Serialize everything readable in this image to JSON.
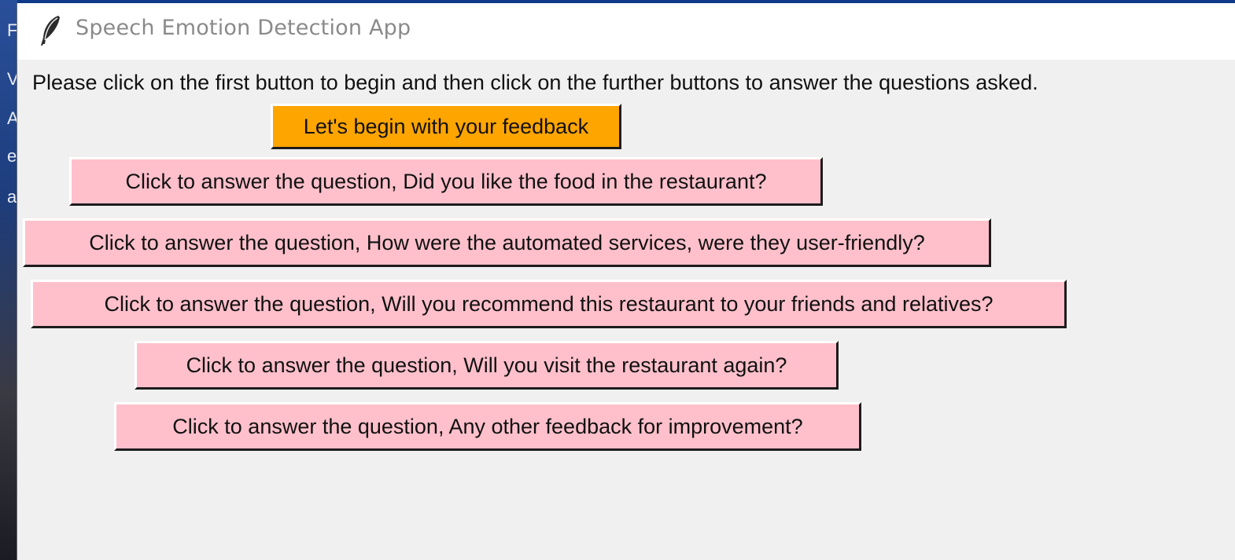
{
  "window": {
    "title": "Speech Emotion Detection App",
    "app_icon": "feather-icon"
  },
  "instruction": "Please click on the first button to begin and then click on the further buttons to answer the questions asked.",
  "begin_button": {
    "label": "Let's begin with your feedback",
    "color": "#ffa500"
  },
  "question_buttons": [
    {
      "label": "Click to answer the question, Did you like the food in the restaurant?"
    },
    {
      "label": "Click to answer the question, How were the automated services, were they user-friendly?"
    },
    {
      "label": "Click to answer the question, Will you recommend this restaurant to your friends and relatives?"
    },
    {
      "label": "Click to answer the question, Will you visit the restaurant again?"
    },
    {
      "label": "Click to answer the question, Any other feedback for improvement?"
    }
  ],
  "colors": {
    "question_button": "#ffc0cb",
    "window_background": "#f0f0f0"
  }
}
